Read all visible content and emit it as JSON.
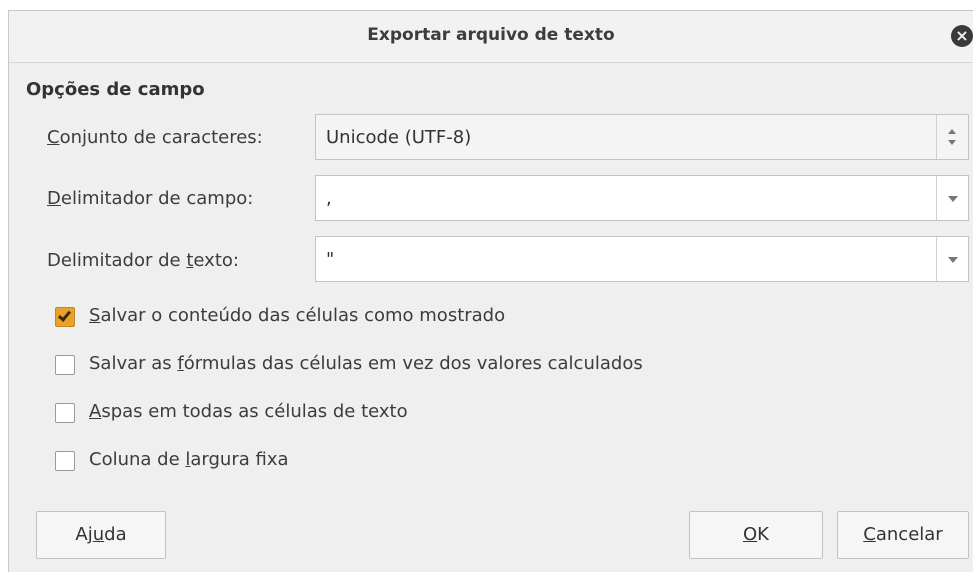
{
  "dialog": {
    "title": "Exportar arquivo de texto",
    "close_glyph": "×"
  },
  "section": {
    "title": "Opções de campo"
  },
  "fields": {
    "charset": {
      "label_mnemonic": "C",
      "label_rest": "onjunto de caracteres:",
      "value": "Unicode (UTF-8)"
    },
    "field_delimiter": {
      "label_mnemonic": "D",
      "label_rest": "elimitador de campo:",
      "value": ","
    },
    "text_delimiter": {
      "label_before": "Delimitador de ",
      "label_mnemonic": "t",
      "label_after": "exto:",
      "value": "\""
    }
  },
  "options": [
    {
      "before": "",
      "mnemonic": "S",
      "after": "alvar o conteúdo das células como mostrado",
      "checked": true
    },
    {
      "before": "Salvar as ",
      "mnemonic": "f",
      "after": "órmulas das células em vez dos valores calculados",
      "checked": false
    },
    {
      "before": "",
      "mnemonic": "A",
      "after": "spas em todas as células de texto",
      "checked": false
    },
    {
      "before": "Coluna de ",
      "mnemonic": "l",
      "after": "argura fixa",
      "checked": false
    }
  ],
  "buttons": {
    "help": {
      "before": "Aj",
      "mnemonic": "u",
      "after": "da"
    },
    "ok": {
      "before": "",
      "mnemonic": "O",
      "after": "K"
    },
    "cancel": {
      "before": "",
      "mnemonic": "C",
      "after": "ancelar"
    }
  },
  "colors": {
    "checkbox_checked": "#e8a22c",
    "window_bg": "#efefef"
  }
}
